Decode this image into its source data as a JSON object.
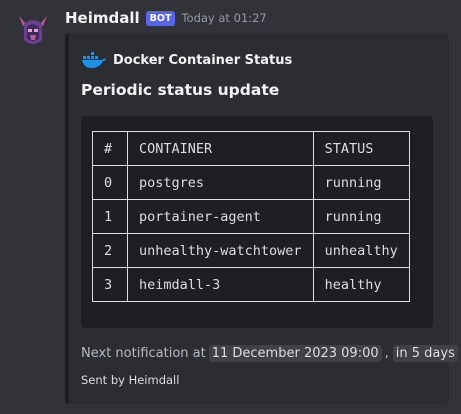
{
  "message": {
    "username": "Heimdall",
    "badge": "BOT",
    "timestamp": "Today at 01:27",
    "avatar_icon": "viking-helmet-avatar-icon"
  },
  "embed": {
    "author_icon": "docker-whale-icon",
    "author_name": "Docker Container Status",
    "title": "Periodic status update",
    "table": {
      "headers": [
        "#",
        "CONTAINER",
        "STATUS"
      ],
      "rows": [
        [
          "0",
          "postgres",
          "running"
        ],
        [
          "1",
          "portainer-agent",
          "running"
        ],
        [
          "2",
          "unhealthy-watchtower",
          "unhealthy"
        ],
        [
          "3",
          "heimdall-3",
          "healthy"
        ]
      ]
    },
    "footer_prefix": "Next notification at",
    "next_time": "11 December 2023 09:00",
    "separator": ",",
    "relative_time": "in 5 days",
    "sent_by": "Sent by Heimdall"
  },
  "colors": {
    "background": "#313338",
    "embed_bg": "#2b2d31",
    "code_bg": "#1e1f22",
    "bot_badge": "#5865f2"
  }
}
